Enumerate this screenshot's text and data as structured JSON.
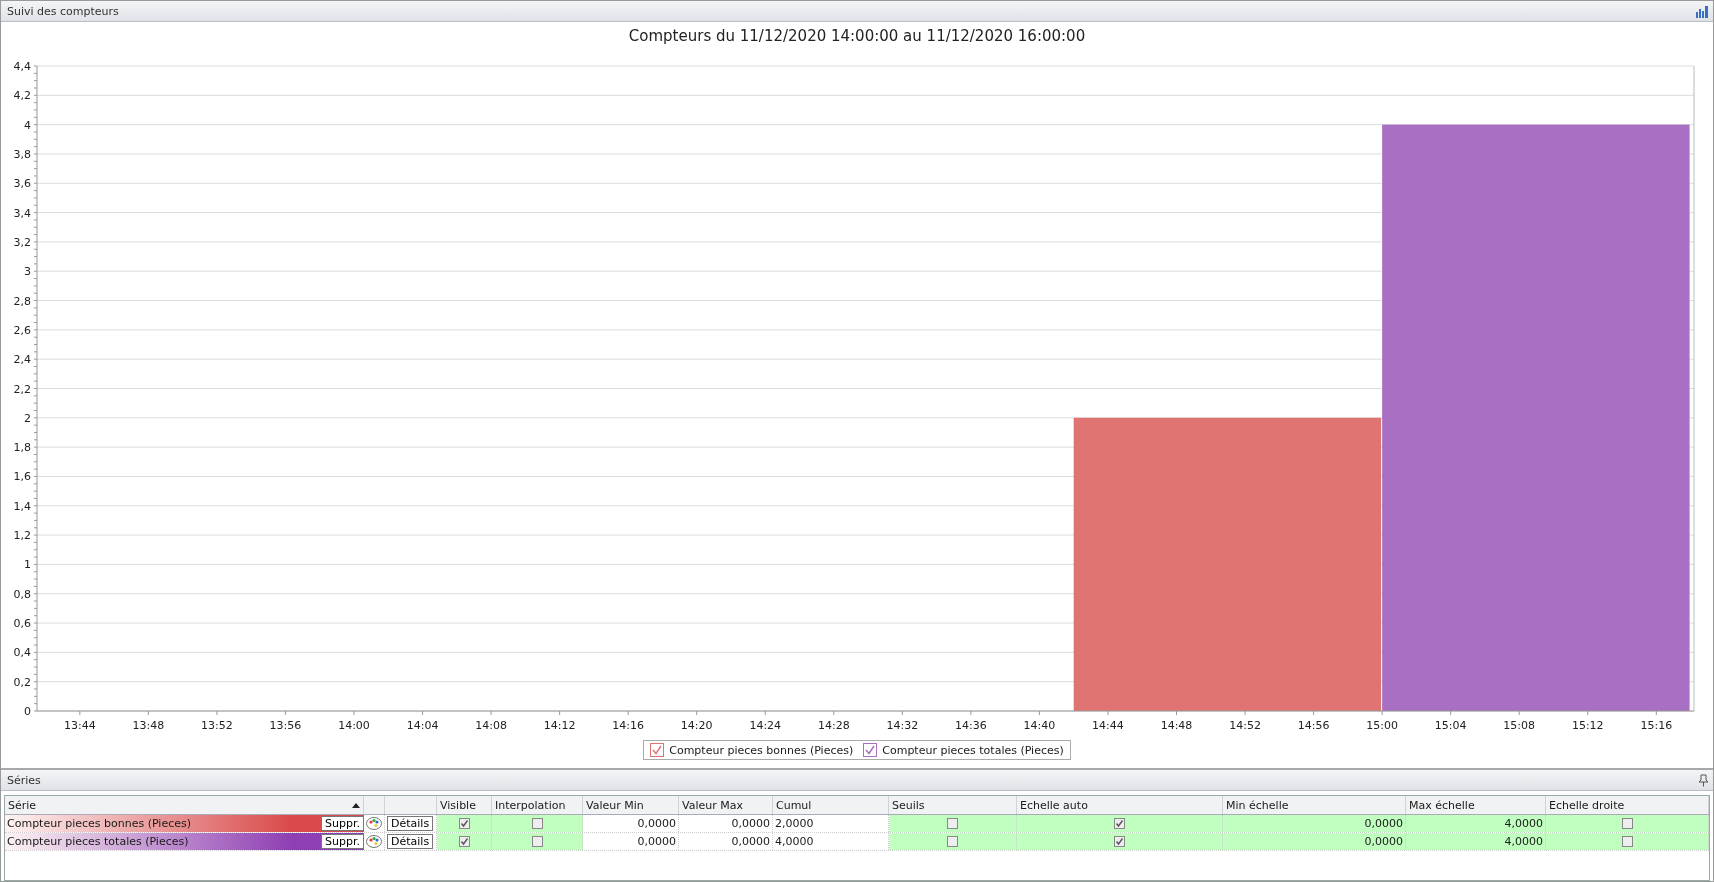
{
  "header": {
    "title": "Suivi des compteurs"
  },
  "chart": {
    "chart_data": {
      "type": "bar",
      "title": "Compteurs du 11/12/2020 14:00:00 au 11/12/2020 16:00:00",
      "x": [
        891,
        909
      ],
      "xlim": [
        821.5,
        918.2
      ],
      "ylim": [
        0,
        4.4
      ],
      "grid": true,
      "xticks": [
        {
          "value": 824,
          "label": "13:44"
        },
        {
          "value": 828,
          "label": "13:48"
        },
        {
          "value": 832,
          "label": "13:52"
        },
        {
          "value": 836,
          "label": "13:56"
        },
        {
          "value": 840,
          "label": "14:00"
        },
        {
          "value": 844,
          "label": "14:04"
        },
        {
          "value": 848,
          "label": "14:08"
        },
        {
          "value": 852,
          "label": "14:12"
        },
        {
          "value": 856,
          "label": "14:16"
        },
        {
          "value": 860,
          "label": "14:20"
        },
        {
          "value": 864,
          "label": "14:24"
        },
        {
          "value": 868,
          "label": "14:28"
        },
        {
          "value": 872,
          "label": "14:32"
        },
        {
          "value": 876,
          "label": "14:36"
        },
        {
          "value": 880,
          "label": "14:40"
        },
        {
          "value": 884,
          "label": "14:44"
        },
        {
          "value": 888,
          "label": "14:48"
        },
        {
          "value": 892,
          "label": "14:52"
        },
        {
          "value": 896,
          "label": "14:56"
        },
        {
          "value": 900,
          "label": "15:00"
        },
        {
          "value": 904,
          "label": "15:04"
        },
        {
          "value": 908,
          "label": "15:08"
        },
        {
          "value": 912,
          "label": "15:12"
        },
        {
          "value": 916,
          "label": "15:16"
        }
      ],
      "yticks": [
        0,
        {
          "value": 0.2,
          "label": "0,2"
        },
        {
          "value": 0.4,
          "label": "0,4"
        },
        {
          "value": 0.6,
          "label": "0,6"
        },
        {
          "value": 0.8,
          "label": "0,8"
        },
        1,
        {
          "value": 1.2,
          "label": "1,2"
        },
        {
          "value": 1.4,
          "label": "1,4"
        },
        {
          "value": 1.6,
          "label": "1,6"
        },
        {
          "value": 1.8,
          "label": "1,8"
        },
        2,
        {
          "value": 2.2,
          "label": "2,2"
        },
        {
          "value": 2.4,
          "label": "2,4"
        },
        {
          "value": 2.6,
          "label": "2,6"
        },
        {
          "value": 2.8,
          "label": "2,8"
        },
        3,
        {
          "value": 3.2,
          "label": "3,2"
        },
        {
          "value": 3.4,
          "label": "3,4"
        },
        {
          "value": 3.6,
          "label": "3,6"
        },
        {
          "value": 3.8,
          "label": "3,8"
        },
        4,
        {
          "value": 4.2,
          "label": "4,2"
        },
        {
          "value": 4.4,
          "label": "4,4"
        }
      ],
      "series": [
        {
          "name": "Compteur pieces bonnes (Pieces)",
          "color": "#e07472",
          "values": [
            2,
            null
          ]
        },
        {
          "name": "Compteur pieces totales (Pieces)",
          "color": "#a86fc2",
          "values": [
            null,
            4
          ]
        }
      ]
    },
    "legend": [
      {
        "checked": true
      },
      {
        "checked": true
      }
    ]
  },
  "series_panel": {
    "title": "Séries",
    "columns": [
      "Série",
      "",
      "",
      "Visible",
      "Interpolation",
      "Valeur Min",
      "Valeur Max",
      "Cumul",
      "Seuils",
      "Echelle auto",
      "Min échelle",
      "Max échelle",
      "Echelle droite"
    ],
    "rows": [
      {
        "name": "Compteur pieces bonnes (Pieces)",
        "color": "#d94a4a",
        "delete": "Suppr.",
        "details": "Détails",
        "visible": true,
        "interpolation": false,
        "min": "0,0000",
        "max": "0,0000",
        "cumul": "2,0000",
        "seuils": false,
        "auto_scale": true,
        "scale_min": "0,0000",
        "scale_max": "4,0000",
        "right_scale": false
      },
      {
        "name": "Compteur pieces totales (Pieces)",
        "color": "#8e3fb3",
        "delete": "Suppr.",
        "details": "Détails",
        "visible": true,
        "interpolation": false,
        "min": "0,0000",
        "max": "0,0000",
        "cumul": "4,0000",
        "seuils": false,
        "auto_scale": true,
        "scale_min": "0,0000",
        "scale_max": "4,0000",
        "right_scale": false
      }
    ]
  }
}
